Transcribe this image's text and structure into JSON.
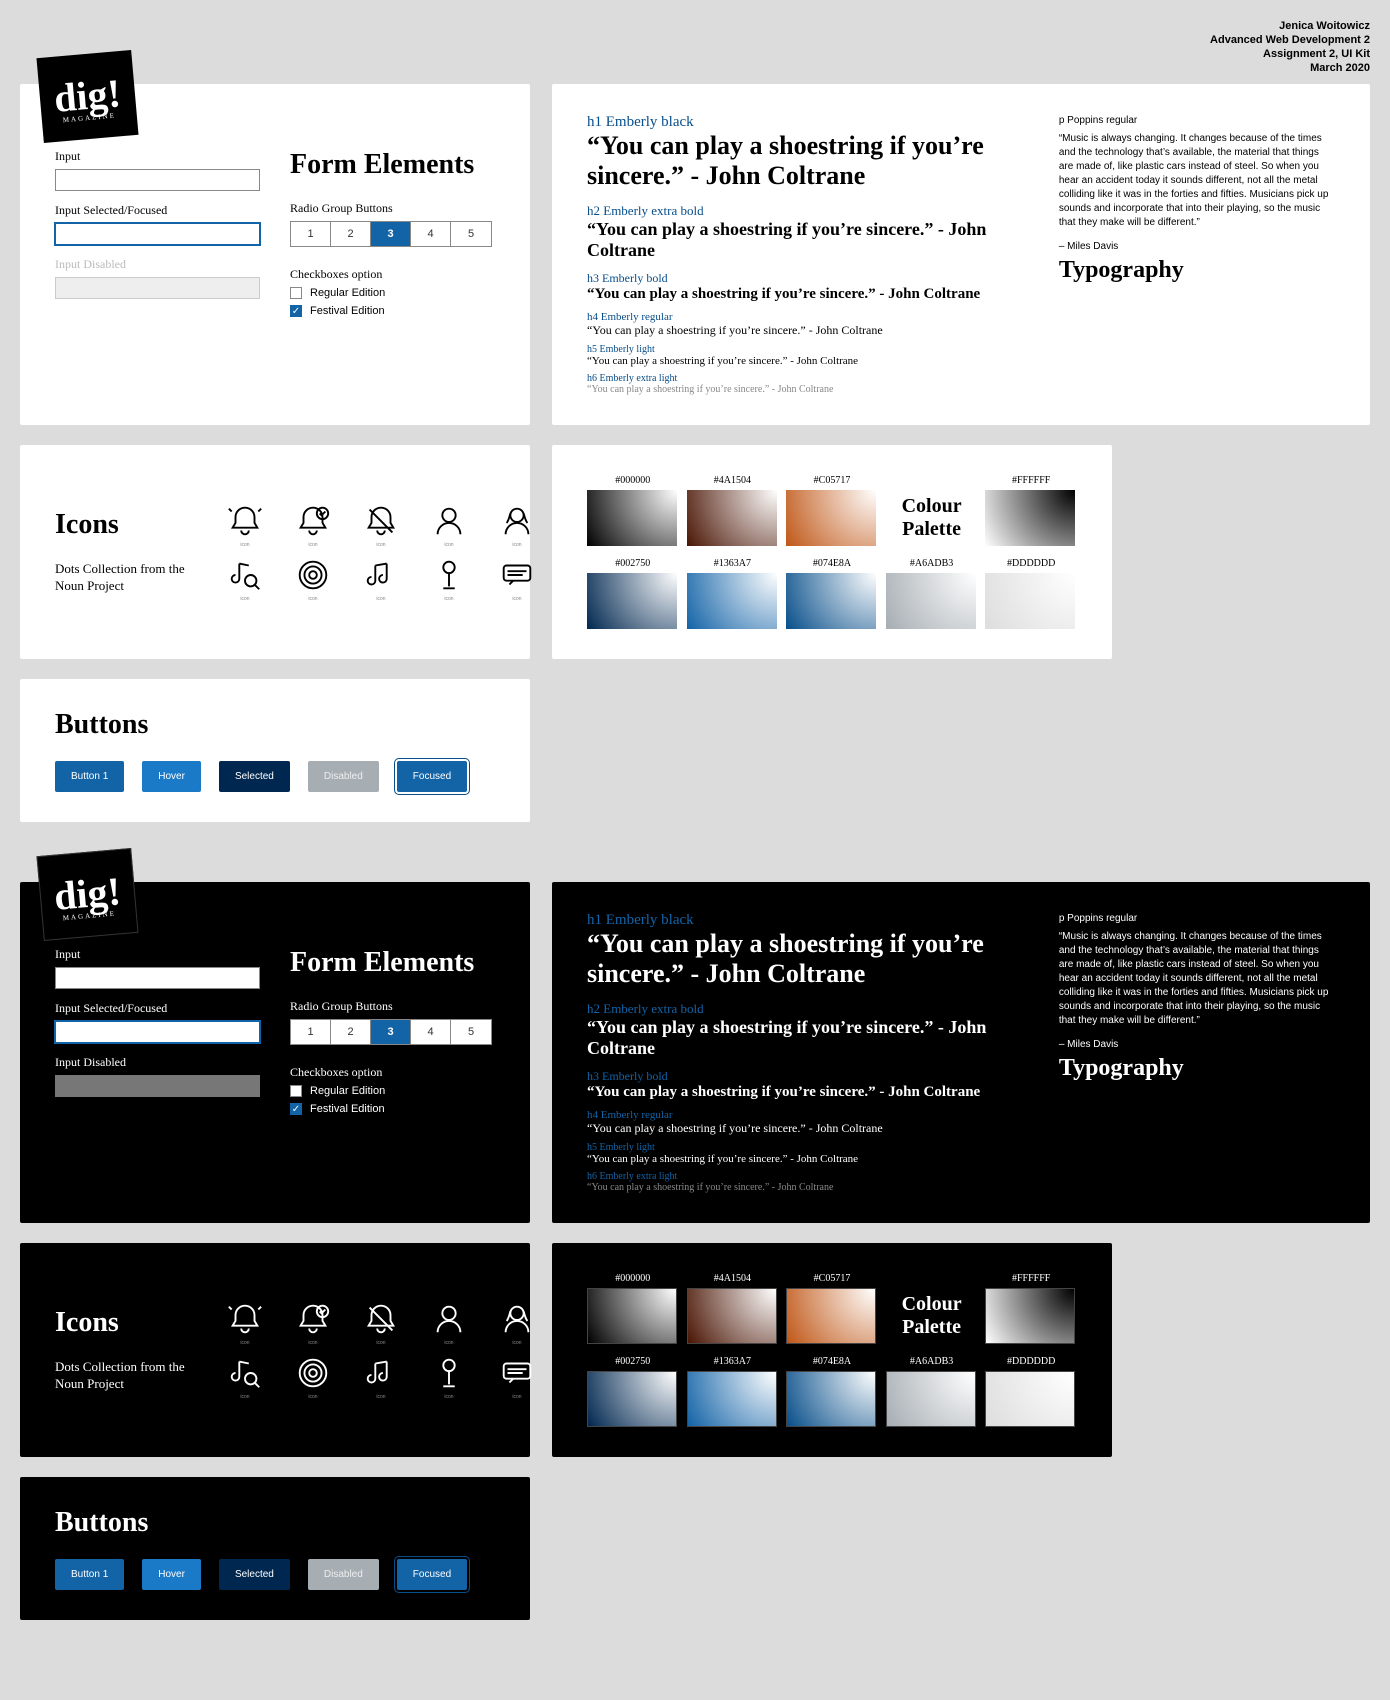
{
  "meta": {
    "author": "Jenica Woitowicz",
    "course": "Advanced Web Development 2",
    "assignment": "Assignment 2, UI Kit",
    "date": "March 2020"
  },
  "logo": {
    "text": "dig!",
    "sub": "MAGAZINE"
  },
  "forms": {
    "title": "Form Elements",
    "input_label": "Input",
    "input_focused_label": "Input Selected/Focused",
    "input_disabled_label": "Input Disabled",
    "radio_label": "Radio Group Buttons",
    "radio_options": [
      "1",
      "2",
      "3",
      "4",
      "5"
    ],
    "radio_active": "3",
    "checkbox_label": "Checkboxes option",
    "checkbox_options": [
      {
        "label": "Regular Edition",
        "checked": false
      },
      {
        "label": "Festival Edition",
        "checked": true
      }
    ]
  },
  "typography": {
    "h1_label": "h1 Emberly black",
    "h1": "“You can play a shoestring if you’re sincere.” - John Coltrane",
    "h2_label": "h2 Emberly extra bold",
    "h2": "“You can play a shoestring if you’re sincere.” - John Coltrane",
    "h3_label": "h3 Emberly bold",
    "h3": "“You can play a shoestring if you’re sincere.” - John Coltrane",
    "h4_label": "h4 Emberly regular",
    "h4": "“You can play a shoestring if you’re sincere.” - John Coltrane",
    "h5_label": "h5 Emberly light",
    "h5": "“You can play a shoestring if you’re sincere.” - John Coltrane",
    "h6_label": "h6 Emberly extra light",
    "h6": "“You can play a shoestring if you’re sincere.” - John Coltrane",
    "p_label": "p Poppins regular",
    "p_body": "“Music is always changing. It changes because of the times and the technology that’s available, the material that things are made of, like plastic cars instead of steel. So when you hear an accident today it sounds different, not all the metal colliding like it was in the forties and fifties. Musicians pick up sounds and incorporate that into their playing, so the music that they make will be different.”",
    "p_credit": "– Miles Davis",
    "section_title": "Typography"
  },
  "icons": {
    "title": "Icons",
    "subtitle": "Dots Collection from the Noun Project"
  },
  "palette": {
    "title": "Colour Palette",
    "row1": [
      "#000000",
      "#4A1504",
      "#C05717",
      "",
      "#FFFFFF"
    ],
    "row2": [
      "#002750",
      "#1363A7",
      "#074E8A",
      "#A6ADB3",
      "#DDDDDD"
    ]
  },
  "buttons": {
    "title": "Buttons",
    "items": [
      "Button 1",
      "Hover",
      "Selected",
      "Disabled",
      "Focused"
    ]
  }
}
